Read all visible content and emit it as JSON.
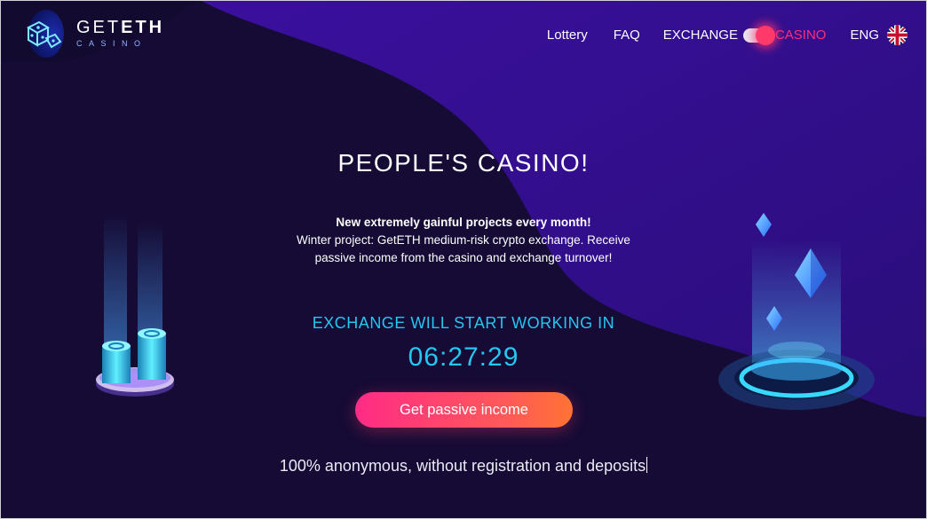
{
  "header": {
    "logo_title_light": "GET",
    "logo_title_bold": "ETH",
    "logo_subtitle": "CASINO",
    "nav": {
      "lottery": "Lottery",
      "faq": "FAQ",
      "exchange": "EXCHANGE",
      "casino": "CASINO",
      "language": "ENG"
    },
    "mode_toggle_active": "CASINO"
  },
  "hero": {
    "title": "PEOPLE'S CASINO!",
    "desc_bold": "New extremely gainful projects every month!",
    "desc_text": "Winter project: GetETH medium-risk crypto exchange. Receive passive income from the casino and exchange turnover!",
    "countdown_label": "EXCHANGE WILL START WORKING IN",
    "countdown_time": "06:27:29",
    "cta_label": "Get passive income",
    "tagline": "100% anonymous, without registration and deposits"
  },
  "icons": {
    "logo": "dice-icon",
    "flag": "uk-flag-icon",
    "left_illustration": "coin-stacks",
    "right_illustration": "ethereum-crystals"
  },
  "colors": {
    "background": "#130a2e",
    "accent_cyan": "#25c6f0",
    "accent_pink": "#ff2f78",
    "cta_gradient_start": "#ff2b86",
    "cta_gradient_end": "#ff7333"
  }
}
